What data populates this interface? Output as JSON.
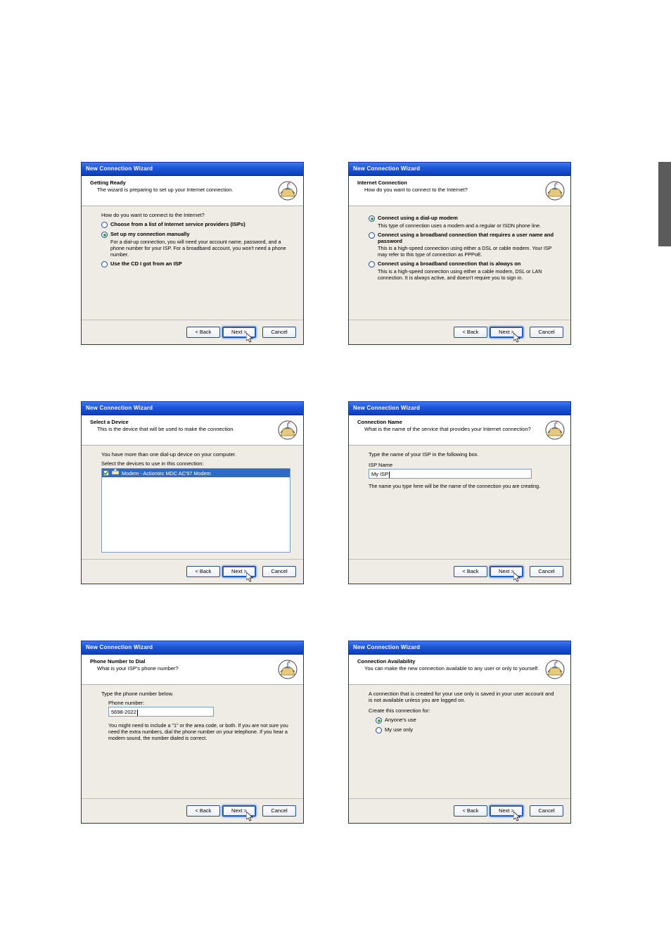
{
  "titlebar": "New Connection Wizard",
  "buttons": {
    "back": "< Back",
    "next": "Next >",
    "cancel": "Cancel"
  },
  "w1": {
    "title": "Getting Ready",
    "desc": "The wizard is preparing to set up your Internet connection.",
    "prompt": "How do you want to connect to the Internet?",
    "opt1": "Choose from a list of Internet service providers (ISPs)",
    "opt2": "Set up my connection manually",
    "opt2_desc": "For a dial-up connection, you will need your account name, password, and a phone number for your ISP. For a broadband account, you won't need a phone number.",
    "opt3": "Use the CD I got from an ISP"
  },
  "w2": {
    "title": "Internet Connection",
    "desc": "How do you want to connect to the Internet?",
    "opt1": "Connect using a dial-up modem",
    "opt1_desc": "This type of connection uses a modem and a regular or ISDN phone line.",
    "opt2": "Connect using a broadband connection that requires a user name and password",
    "opt2_desc": "This is a high-speed connection using either a DSL or cable modem. Your ISP may refer to this type of connection as PPPoE.",
    "opt3": "Connect using a broadband connection that is always on",
    "opt3_desc": "This is a high-speed connection using either a cable modem, DSL or LAN connection. It is always active, and doesn't require you to sign in."
  },
  "w3": {
    "title": "Select a Device",
    "desc": "This is the device that will be used to make the connection.",
    "line1": "You have more than one dial-up device on your computer.",
    "line2": "Select the devices to use in this connection:",
    "device": "Modem - Actiontec MDC AC'97 Modem"
  },
  "w4": {
    "title": "Connection Name",
    "desc": "What is the name of the service that provides your Internet connection?",
    "line1": "Type the name of your ISP in the following box.",
    "label": "ISP Name",
    "value": "My ISP",
    "hint": "The name you type here will be the name of the connection you are creating."
  },
  "w5": {
    "title": "Phone Number to Dial",
    "desc": "What is your ISP's phone number?",
    "line1": "Type the phone number below.",
    "label": "Phone number:",
    "value": "5698-2022",
    "hint": "You might need to include a \"1\" or the area code, or both. If you are not sure you need the extra numbers, dial the phone number on your telephone. If you hear a modem sound, the number dialed is correct."
  },
  "w6": {
    "title": "Connection Availability",
    "desc": "You can make the new connection available to any user or only to yourself.",
    "line1": "A connection that is created for your use only is saved in your user account and is not available unless you are logged on.",
    "line2": "Create this connection for:",
    "opt1": "Anyone's use",
    "opt2": "My use only"
  }
}
